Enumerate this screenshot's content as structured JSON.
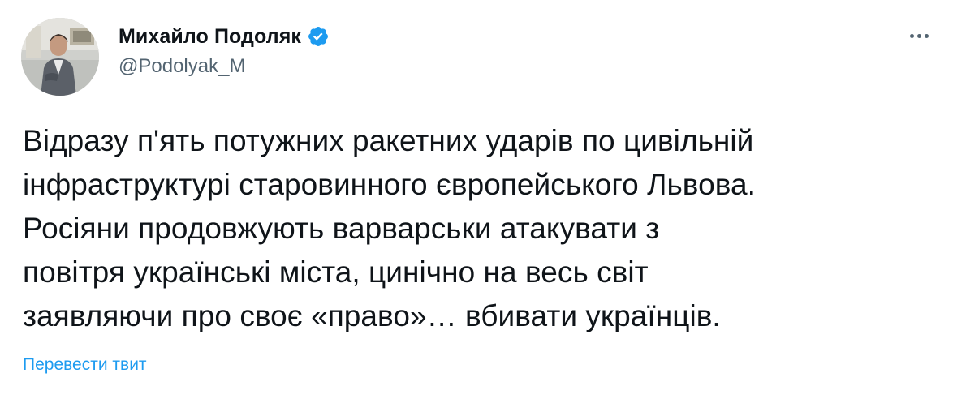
{
  "author": {
    "name": "Михайло Подоляк",
    "handle": "@Podolyak_M",
    "verified": true,
    "avatar_icon": "profile-photo"
  },
  "tweet": {
    "text": "Відразу п'ять потужних ракетних ударів по цивільній\nінфраструктурі старовинного європейського Львова.\nРосіяни продовжують варварськи атакувати з\nповітря українські міста, цинічно на весь світ\nзаявляючи про своє «право»… вбивати українців.",
    "translate_label": "Перевести твит"
  },
  "actions": {
    "more_icon": "more-horizontal-icon"
  },
  "colors": {
    "text": "#0f1419",
    "secondary": "#536471",
    "accent": "#1d9bf0"
  }
}
